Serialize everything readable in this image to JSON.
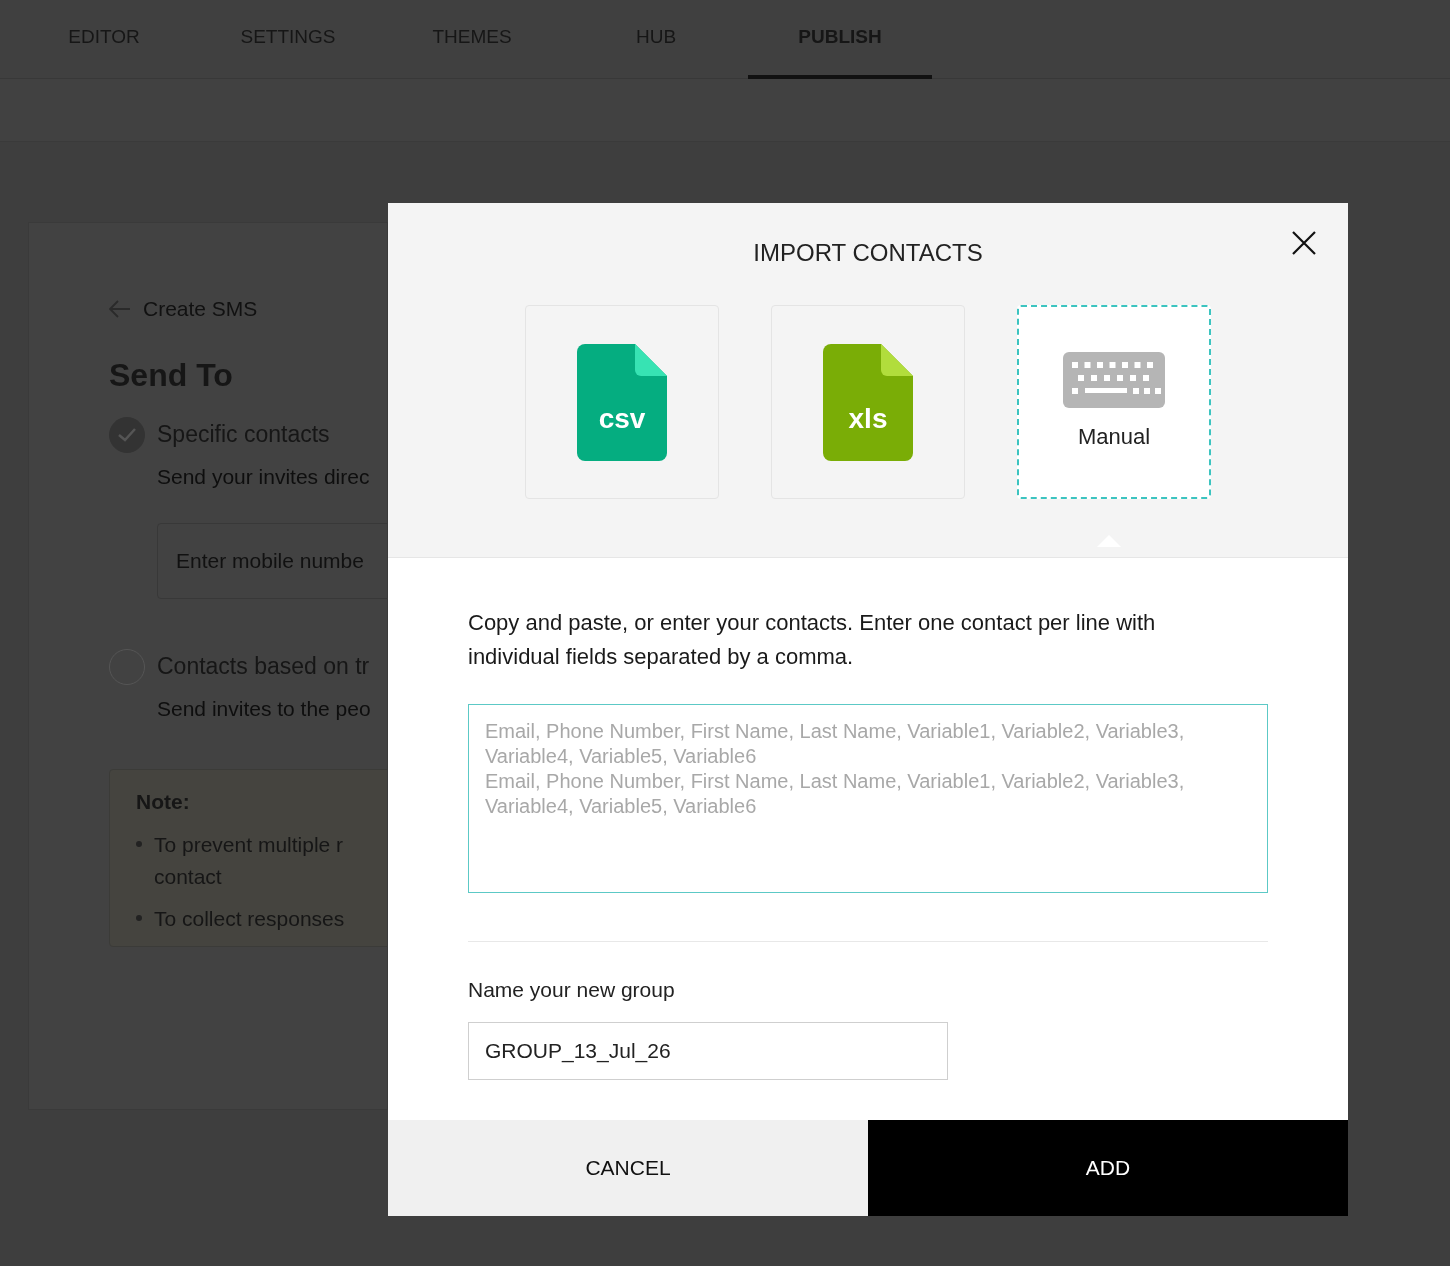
{
  "tabs": [
    {
      "label": "EDITOR",
      "selected": false
    },
    {
      "label": "SETTINGS",
      "selected": false
    },
    {
      "label": "THEMES",
      "selected": false
    },
    {
      "label": "HUB",
      "selected": false
    },
    {
      "label": "PUBLISH",
      "selected": true
    }
  ],
  "background_page": {
    "back_link": "Create SMS",
    "heading": "Send To",
    "options": [
      {
        "label": "Specific contacts",
        "description": "Send your invites direc",
        "selected": true
      },
      {
        "label": "Contacts based on tr",
        "description": "Send invites to the peo",
        "selected": false
      }
    ],
    "mobile_field": {
      "placeholder": "Enter mobile numbe"
    },
    "note": {
      "title": "Note:",
      "items": [
        "To prevent multiple r contact",
        "To collect responses"
      ]
    }
  },
  "dialog": {
    "title": "IMPORT CONTACTS",
    "sources": [
      {
        "kind": "csv",
        "label": "csv",
        "selected": false
      },
      {
        "kind": "xls",
        "label": "xls",
        "selected": false
      },
      {
        "kind": "manual",
        "label": "Manual",
        "selected": true
      }
    ],
    "instructions": "Copy and paste, or enter your contacts. Enter one contact per line with individual fields separated by a comma.",
    "contacts_field": {
      "placeholder": "Email, Phone Number, First Name, Last Name, Variable1, Variable2, Variable3, Variable4, Variable5, Variable6\nEmail, Phone Number, First Name, Last Name, Variable1, Variable2, Variable3, Variable4, Variable5, Variable6"
    },
    "group_label": "Name your new group",
    "group_field": {
      "value": "GROUP_13_Jul_26"
    },
    "buttons": [
      {
        "kind": "cancel",
        "label": "CANCEL"
      },
      {
        "kind": "add",
        "label": "ADD"
      }
    ]
  }
}
